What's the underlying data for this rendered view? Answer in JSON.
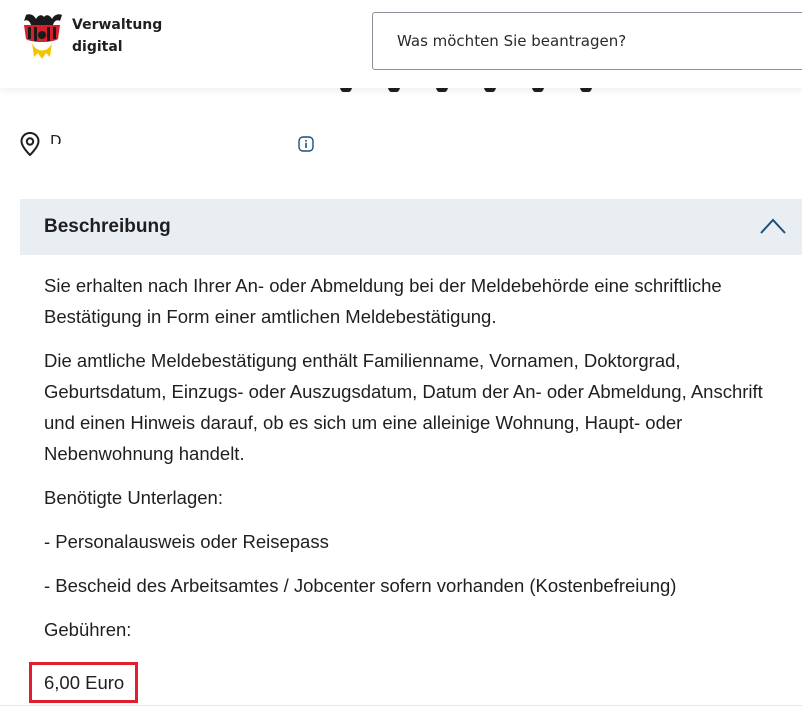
{
  "header": {
    "logo_icon": "eagle-icon",
    "brand_line1": "Verwaltung",
    "brand_line2": "digital",
    "search_placeholder": "Was möchten Sie beantragen?"
  },
  "location": {
    "pin_icon": "location-pin-icon",
    "text": "D",
    "info_icon": "info-icon"
  },
  "accordion": {
    "title": "Beschreibung",
    "expanded": true,
    "toggle_icon": "chevron-up-icon"
  },
  "content": {
    "p1": "Sie erhalten nach Ihrer An- oder Abmeldung bei der Meldebehörde eine schriftliche Bestätigung in Form einer amtlichen Meldebestätigung.",
    "p2": "Die amtliche Meldebestätigung enthält Familienname, Vornamen, Doktorgrad, Geburtsdatum, Einzugs- oder Auszugsdatum, Datum der An- oder Abmeldung, Anschrift und einen Hinweis darauf, ob es sich um eine alleinige Wohnung, Haupt- oder Nebenwohnung handelt.",
    "p3": "Benötigte Unterlagen:",
    "p4": "- Personalausweis oder Reisepass",
    "p5": "- Bescheid des Arbeitsamtes / Jobcenter sofern vorhanden (Kostenbefreiung)",
    "p6": "Gebühren:",
    "fee": "6,00 Euro"
  },
  "colors": {
    "accordion_bg": "#e9eef3",
    "highlight": "#e01e2d",
    "chevron": "#1e4f7a"
  }
}
